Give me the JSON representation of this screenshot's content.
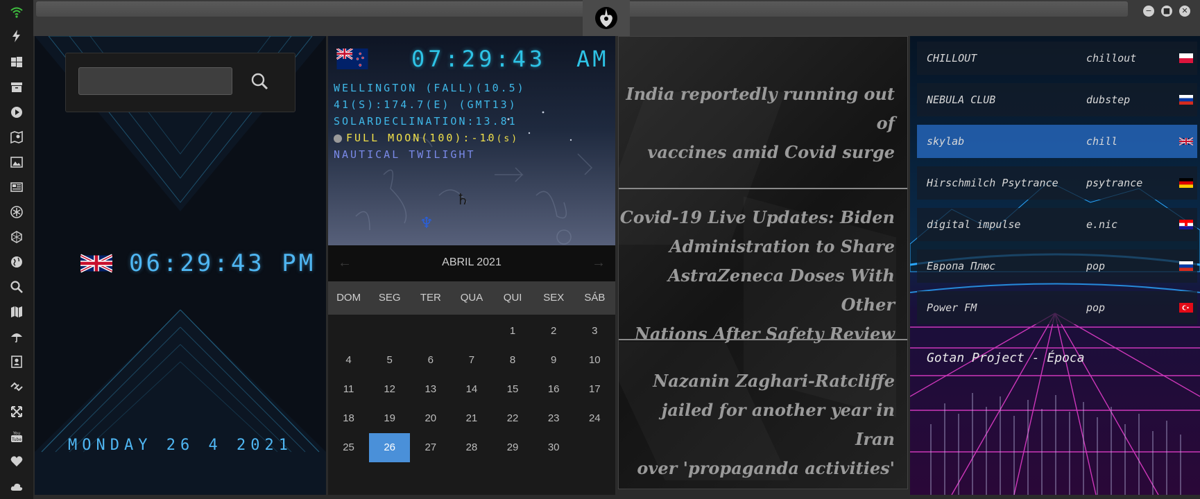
{
  "rail": {
    "icons": [
      "wifi-icon",
      "bolt-icon",
      "windows-icon",
      "archive-icon",
      "play-icon",
      "map-book-icon",
      "image-icon",
      "news-icon",
      "snowflake-icon",
      "globe-mesh-icon",
      "globe-icon",
      "search-icon",
      "map-icon",
      "umbrella-icon",
      "contact-icon",
      "link-icon",
      "expand-icon",
      "youtube-icon",
      "heart-icon",
      "cloud-icon"
    ],
    "accent": "#3fbf3f"
  },
  "window": {
    "emblem": "rebel-alliance-icon",
    "controls": [
      "minimize-icon",
      "maximize-icon",
      "close-icon"
    ]
  },
  "search": {
    "placeholder": "",
    "value": ""
  },
  "clock_uk": {
    "flag": "united-kingdom-flag",
    "time": "06:29:43 PM",
    "date": "MONDAY 26 4 2021"
  },
  "astro": {
    "flag": "new-zealand-flag",
    "time": "07:29:43",
    "ampm": "AM",
    "line1": "WELLINGTON (FALL)(10.5)",
    "line2": "41(S):174.7(E) (GMT13)",
    "line3": "SOLARDECLINATION:13.81",
    "moon": "FULL MOON(100):-10",
    "moon_suffix": "(s)",
    "twilight": "NAUTICAL TWILIGHT",
    "saturn_glyph": "♄",
    "neptune_glyph": "♆"
  },
  "calendar": {
    "month_label": "ABRIL 2021",
    "prev": "←",
    "next": "→",
    "weekdays": [
      "DOM",
      "SEG",
      "TER",
      "QUA",
      "QUI",
      "SEX",
      "SÁB"
    ],
    "weeks": [
      [
        "",
        "",
        "",
        "",
        "1",
        "2",
        "3"
      ],
      [
        "4",
        "5",
        "6",
        "7",
        "8",
        "9",
        "10"
      ],
      [
        "11",
        "12",
        "13",
        "14",
        "15",
        "16",
        "17"
      ],
      [
        "18",
        "19",
        "20",
        "21",
        "22",
        "23",
        "24"
      ],
      [
        "25",
        "26",
        "27",
        "28",
        "29",
        "30",
        ""
      ]
    ],
    "selected": "26",
    "selected_color": "#4a90d9"
  },
  "news": [
    {
      "lines": [
        "India reportedly running out of",
        "vaccines amid Covid surge"
      ]
    },
    {
      "lines": [
        "Covid-19 Live Updates: Biden",
        "Administration to Share",
        "AstraZeneca Doses With Other",
        "Nations After Safety Review"
      ]
    },
    {
      "lines": [
        "Nazanin Zaghari-Ratcliffe",
        "jailed for another year in Iran",
        "over 'propaganda activities'"
      ]
    }
  ],
  "radio": {
    "stations": [
      {
        "name": "CHILLOUT",
        "genre": "chillout",
        "flag": "poland-flag"
      },
      {
        "name": "NEBULA CLUB",
        "genre": "dubstep",
        "flag": "russia-flag"
      },
      {
        "name": "skylab",
        "genre": "chill",
        "flag": "united-kingdom-flag"
      },
      {
        "name": "Hirschmilch Psytrance",
        "genre": "psytrance",
        "flag": "germany-flag"
      },
      {
        "name": "digital impulse",
        "genre": "e.nic",
        "flag": "croatia-flag"
      },
      {
        "name": "Европа Плюс",
        "genre": "pop",
        "flag": "russia-flag"
      },
      {
        "name": "Power FM",
        "genre": "pop",
        "flag": "turkey-flag"
      }
    ],
    "selected_index": 2,
    "now_playing": "Gotan Project - Época",
    "accent_pink": "#e03cc8",
    "accent_cyan": "#2aa8ff"
  }
}
